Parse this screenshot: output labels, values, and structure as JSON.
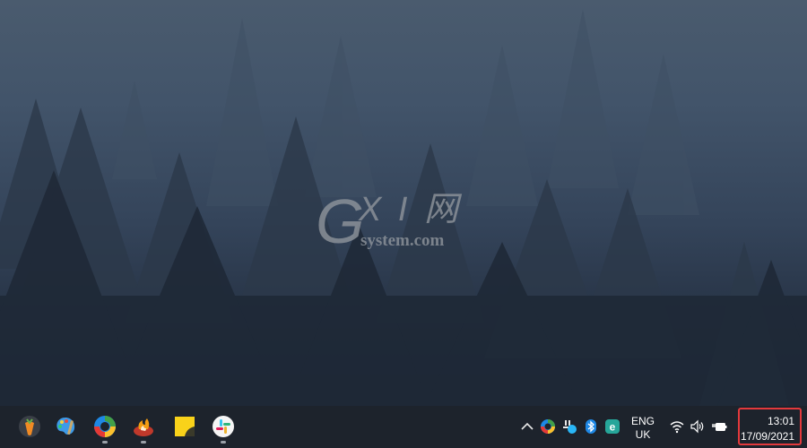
{
  "desktop": {
    "wallpaper": "misty-pine-forest",
    "watermark": {
      "letter": "G",
      "xi": "X I 网",
      "site": "system.com"
    }
  },
  "taskbar": {
    "pinned_apps": [
      {
        "name": "FL Studio",
        "icon": "fl-studio-icon",
        "running": false
      },
      {
        "name": "Paint",
        "icon": "paint-palette-icon",
        "running": false
      },
      {
        "name": "Microsoft Edge Canary",
        "icon": "edge-icon",
        "running": true
      },
      {
        "name": "Burning app",
        "icon": "fire-app-icon",
        "running": true
      },
      {
        "name": "Sticky Notes",
        "icon": "sticky-notes-icon",
        "running": false
      },
      {
        "name": "Slack",
        "icon": "slack-icon",
        "running": true
      }
    ],
    "tray": {
      "overflow_icon": "chevron-up-icon",
      "icons": [
        "edge-tray-icon",
        "slack-tray-icon",
        "bluetooth-icon",
        "eset-icon"
      ],
      "language": {
        "line1": "ENG",
        "line2": "UK"
      },
      "status_icons": [
        "wifi-icon",
        "volume-icon",
        "battery-charging-icon"
      ],
      "clock": {
        "time": "13:01",
        "date": "17/09/2021"
      },
      "highlight_color": "#e3393c"
    }
  }
}
